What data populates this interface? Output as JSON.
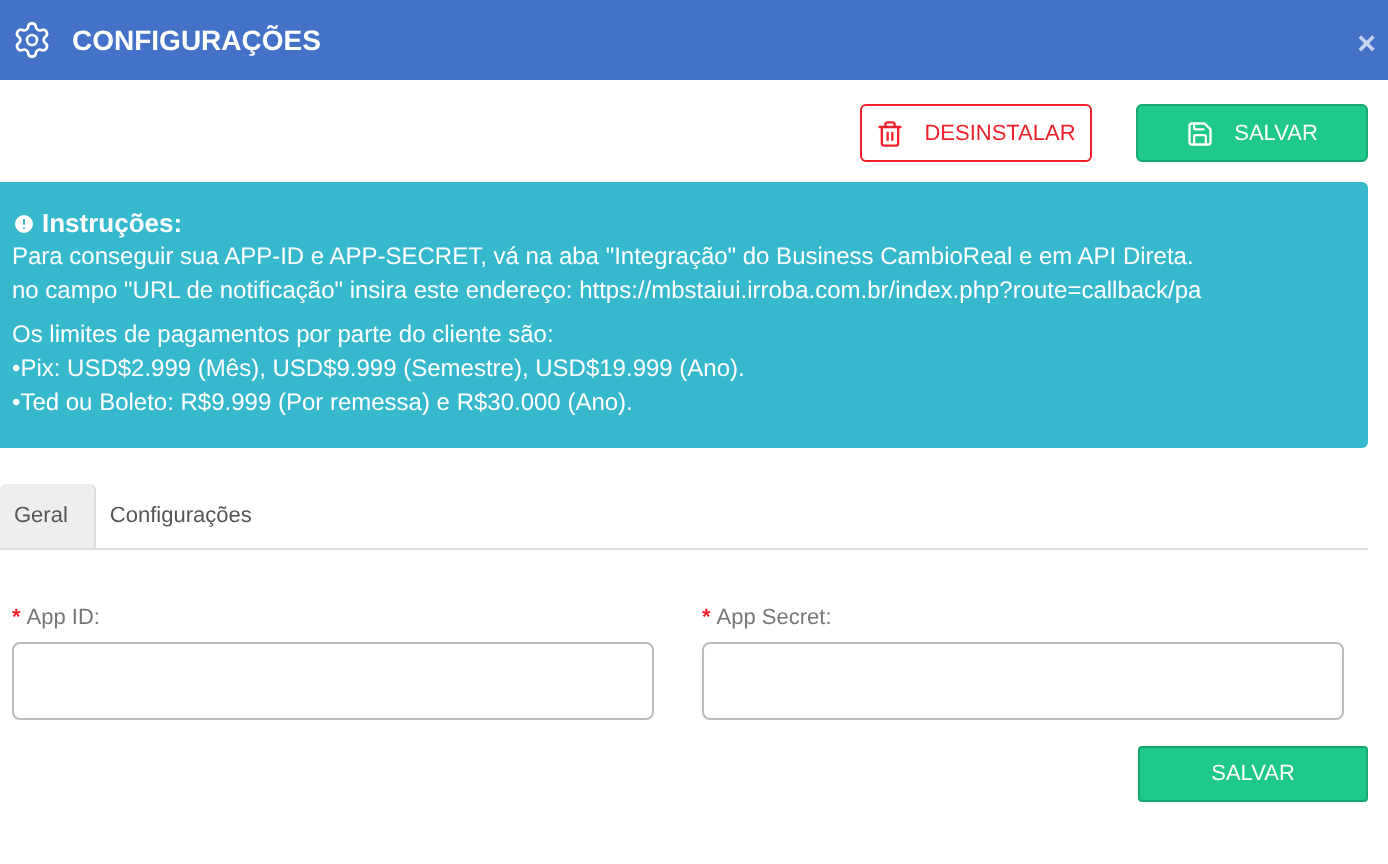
{
  "window": {
    "title": "CONFIGURAÇÕES",
    "close": "×"
  },
  "actions": [
    {
      "kind": "danger",
      "label": "DESINSTALAR"
    },
    {
      "kind": "primary",
      "label": "SALVAR"
    }
  ],
  "instructions": {
    "title": "Instruções:",
    "lines": [
      "Para conseguir sua APP-ID e APP-SECRET, vá na aba \"Integração\" do Business CambioReal e em API Direta.",
      "no campo \"URL de notificação\" insira este endereço:  https://mbstaiui.irroba.com.br/index.php?route=callback/pa"
    ],
    "limits": [
      "Os limites de pagamentos por parte do cliente são:",
      "•Pix: USD$2.999 (Mês), USD$9.999 (Semestre), USD$19.999 (Ano).",
      "•Ted ou Boleto: R$9.999 (Por remessa) e R$30.000 (Ano)."
    ]
  },
  "tabs": [
    {
      "label": "Geral",
      "selected": true
    },
    {
      "label": "Configurações",
      "selected": false
    }
  ],
  "fields": [
    {
      "mark": "*",
      "label": "App ID:"
    },
    {
      "mark": "*",
      "label": "App Secret:"
    }
  ],
  "submit": {
    "label": "SALVAR"
  }
}
